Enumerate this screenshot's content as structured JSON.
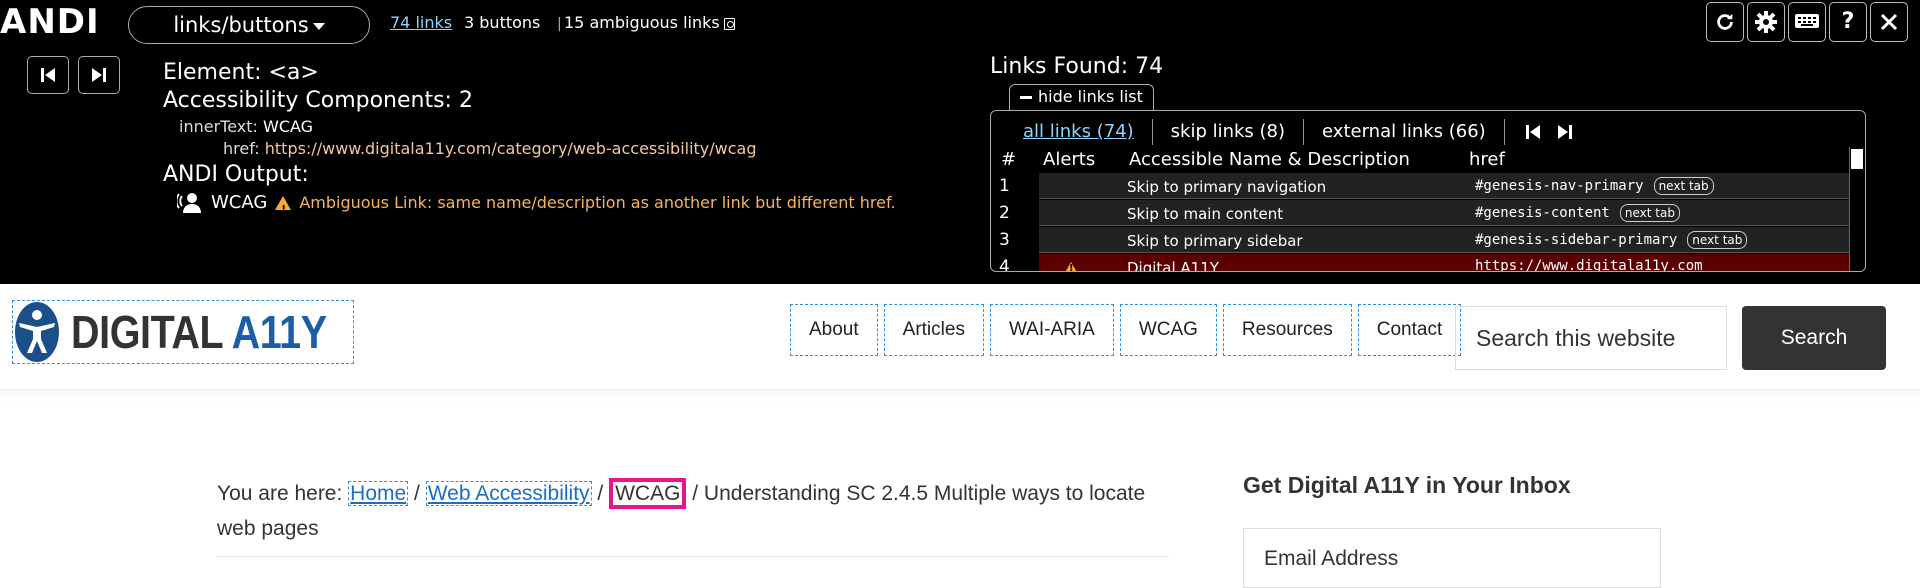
{
  "andi": {
    "logo": "ANDI",
    "module": "links/buttons",
    "stats": {
      "links": "74 links",
      "buttons": "3 buttons",
      "ambiguous": "15 ambiguous links"
    },
    "tools": [
      "refresh-icon",
      "gear-icon",
      "keyboard-icon",
      "help-icon",
      "close-icon"
    ],
    "help_label": "?",
    "element": {
      "line": "Element: <a>",
      "components": "Accessibility Components: 2",
      "innerText_key": "innerText:",
      "innerText_val": "WCAG",
      "href_key": "href:",
      "href_val": "https://www.digitala11y.com/category/web-accessibility/wcag",
      "output_label": "ANDI Output:",
      "output_name": "WCAG",
      "output_warning": "Ambiguous Link: same name/description as another link but different href."
    },
    "links_found": "Links Found: 74",
    "hide_list": "hide links list",
    "tabs": [
      "all links (74)",
      "skip links (8)",
      "external links (66)"
    ],
    "columns": [
      "#",
      "Alerts",
      "Accessible Name & Description",
      "href"
    ],
    "rows": [
      {
        "num": "1",
        "name": "Skip to primary navigation",
        "href": "#genesis-nav-primary",
        "badge": "next tab",
        "alert": false
      },
      {
        "num": "2",
        "name": "Skip to main content",
        "href": "#genesis-content",
        "badge": "next tab",
        "alert": false
      },
      {
        "num": "3",
        "name": "Skip to primary sidebar",
        "href": "#genesis-sidebar-primary",
        "badge": "next tab",
        "alert": false
      },
      {
        "num": "4",
        "name": "Digital A11Y",
        "href": "https://www.digitala11y.com",
        "badge": "",
        "alert": true
      }
    ]
  },
  "site": {
    "brand_dark": "DIGITAL ",
    "brand_accent": "A11Y",
    "nav": [
      "About",
      "Articles",
      "WAI-ARIA",
      "WCAG",
      "Resources",
      "Contact"
    ],
    "search_placeholder": "Search this website",
    "search_button": "Search",
    "breadcrumb": {
      "prefix": "You are here:",
      "home": "Home",
      "web_accessibility": "Web Accessibility",
      "current_link": "WCAG",
      "page": "Understanding SC 2.4.5 Multiple ways to locate web pages"
    },
    "sidebar_title": "Get Digital A11Y in Your Inbox",
    "email_placeholder": "Email Address"
  },
  "colors": {
    "andi_bg": "#000000",
    "link_blue": "#8fd3ff",
    "warning_orange": "#f7a934",
    "highlight_pink": "#e6158a",
    "brand_blue": "#1b5da6"
  }
}
